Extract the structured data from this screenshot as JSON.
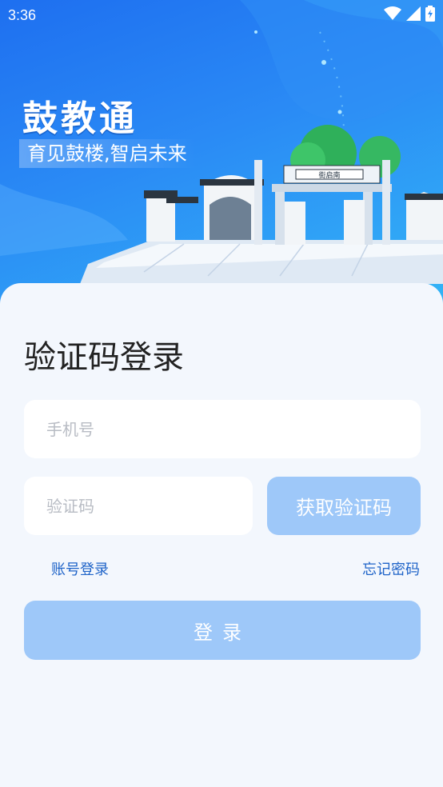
{
  "status_bar": {
    "time": "3:36"
  },
  "hero": {
    "app_name": "鼓教通",
    "slogan": "育见鼓楼,智启未来",
    "gate_sign": "街启南"
  },
  "login": {
    "title": "验证码登录",
    "phone_placeholder": "手机号",
    "code_placeholder": "验证码",
    "get_code_label": "获取验证码",
    "account_login_label": "账号登录",
    "forgot_password_label": "忘记密码",
    "submit_label": "登录"
  },
  "colors": {
    "primary": "#1e63c8",
    "button_disabled": "#9ec8f9",
    "hero_start": "#1e6ff0",
    "hero_end": "#33b4f6"
  },
  "icons": [
    "wifi-icon",
    "cellular-signal-icon",
    "battery-charging-icon"
  ]
}
